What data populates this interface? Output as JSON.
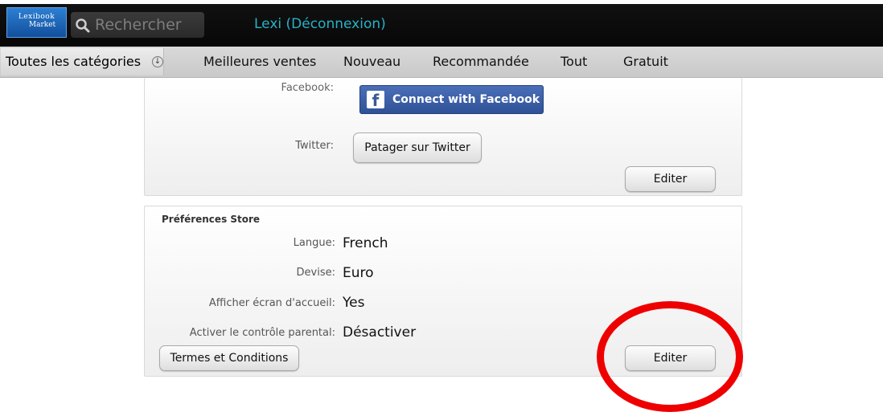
{
  "topbar": {
    "logo": {
      "line1": "Lexibook",
      "line2": "Market"
    },
    "search_placeholder": "Rechercher",
    "user_label": "Lexi  (Déconnexion)"
  },
  "nav": {
    "category_dropdown": "Toutes les catégories",
    "items": [
      "Meilleures ventes",
      "Nouveau",
      "Recommandée",
      "Tout",
      "Gratuit"
    ]
  },
  "social_panel": {
    "facebook_label": "Facebook:",
    "facebook_button": "Connect with Facebook",
    "twitter_label": "Twitter:",
    "twitter_button": "Patager sur Twitter",
    "edit_button": "Editer"
  },
  "store_panel": {
    "title": "Préférences Store",
    "rows": [
      {
        "label": "Langue:",
        "value": "French"
      },
      {
        "label": "Devise:",
        "value": "Euro"
      },
      {
        "label": "Afficher écran d'accueil:",
        "value": "Yes"
      },
      {
        "label": "Activer le contrôle parental:",
        "value": "Désactiver"
      }
    ],
    "terms_button": "Termes et Conditions",
    "edit_button": "Editer"
  },
  "colors": {
    "highlight_circle": "#ee0000",
    "user_link": "#27b2c6",
    "facebook_blue": "#3b5998"
  }
}
